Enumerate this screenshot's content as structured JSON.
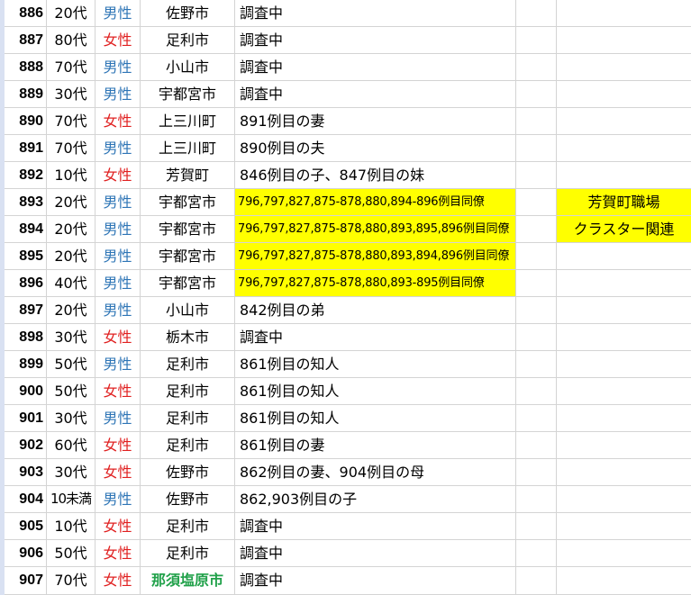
{
  "colors": {
    "male": "#2e75b6",
    "female": "#e02020",
    "highlight": "#ffff00",
    "green_city": "#21a14a",
    "row_header_bg": "#d9e1f2",
    "grid": "#d4d4d4"
  },
  "cluster_note": {
    "line1": "芳賀町職場",
    "line2": "クラスター関連"
  },
  "rows": [
    {
      "num": "886",
      "age": "20代",
      "sex": "男性",
      "city": "佐野市",
      "note": "調査中"
    },
    {
      "num": "887",
      "age": "80代",
      "sex": "女性",
      "city": "足利市",
      "note": "調査中"
    },
    {
      "num": "888",
      "age": "70代",
      "sex": "男性",
      "city": "小山市",
      "note": "調査中"
    },
    {
      "num": "889",
      "age": "30代",
      "sex": "男性",
      "city": "宇都宮市",
      "note": "調査中"
    },
    {
      "num": "890",
      "age": "70代",
      "sex": "女性",
      "city": "上三川町",
      "note": "891例目の妻"
    },
    {
      "num": "891",
      "age": "70代",
      "sex": "男性",
      "city": "上三川町",
      "note": "890例目の夫"
    },
    {
      "num": "892",
      "age": "10代",
      "sex": "女性",
      "city": "芳賀町",
      "note": "846例目の子、847例目の妹"
    },
    {
      "num": "893",
      "age": "20代",
      "sex": "男性",
      "city": "宇都宮市",
      "note": "796,797,827,875-878,880,894-896例目同僚"
    },
    {
      "num": "894",
      "age": "20代",
      "sex": "男性",
      "city": "宇都宮市",
      "note": "796,797,827,875-878,880,893,895,896例目同僚"
    },
    {
      "num": "895",
      "age": "20代",
      "sex": "男性",
      "city": "宇都宮市",
      "note": "796,797,827,875-878,880,893,894,896例目同僚"
    },
    {
      "num": "896",
      "age": "40代",
      "sex": "男性",
      "city": "宇都宮市",
      "note": "796,797,827,875-878,880,893-895例目同僚"
    },
    {
      "num": "897",
      "age": "20代",
      "sex": "男性",
      "city": "小山市",
      "note": "842例目の弟"
    },
    {
      "num": "898",
      "age": "30代",
      "sex": "女性",
      "city": "栃木市",
      "note": "調査中"
    },
    {
      "num": "899",
      "age": "50代",
      "sex": "男性",
      "city": "足利市",
      "note": "861例目の知人"
    },
    {
      "num": "900",
      "age": "50代",
      "sex": "女性",
      "city": "足利市",
      "note": "861例目の知人"
    },
    {
      "num": "901",
      "age": "30代",
      "sex": "男性",
      "city": "足利市",
      "note": "861例目の知人"
    },
    {
      "num": "902",
      "age": "60代",
      "sex": "女性",
      "city": "足利市",
      "note": "861例目の妻"
    },
    {
      "num": "903",
      "age": "30代",
      "sex": "女性",
      "city": "佐野市",
      "note": "862例目の妻、904例目の母"
    },
    {
      "num": "904",
      "age": "10未満",
      "sex": "男性",
      "city": "佐野市",
      "note": "862,903例目の子"
    },
    {
      "num": "905",
      "age": "10代",
      "sex": "女性",
      "city": "足利市",
      "note": "調査中"
    },
    {
      "num": "906",
      "age": "50代",
      "sex": "女性",
      "city": "足利市",
      "note": "調査中"
    },
    {
      "num": "907",
      "age": "70代",
      "sex": "女性",
      "city": "那須塩原市",
      "note": "調査中"
    }
  ]
}
